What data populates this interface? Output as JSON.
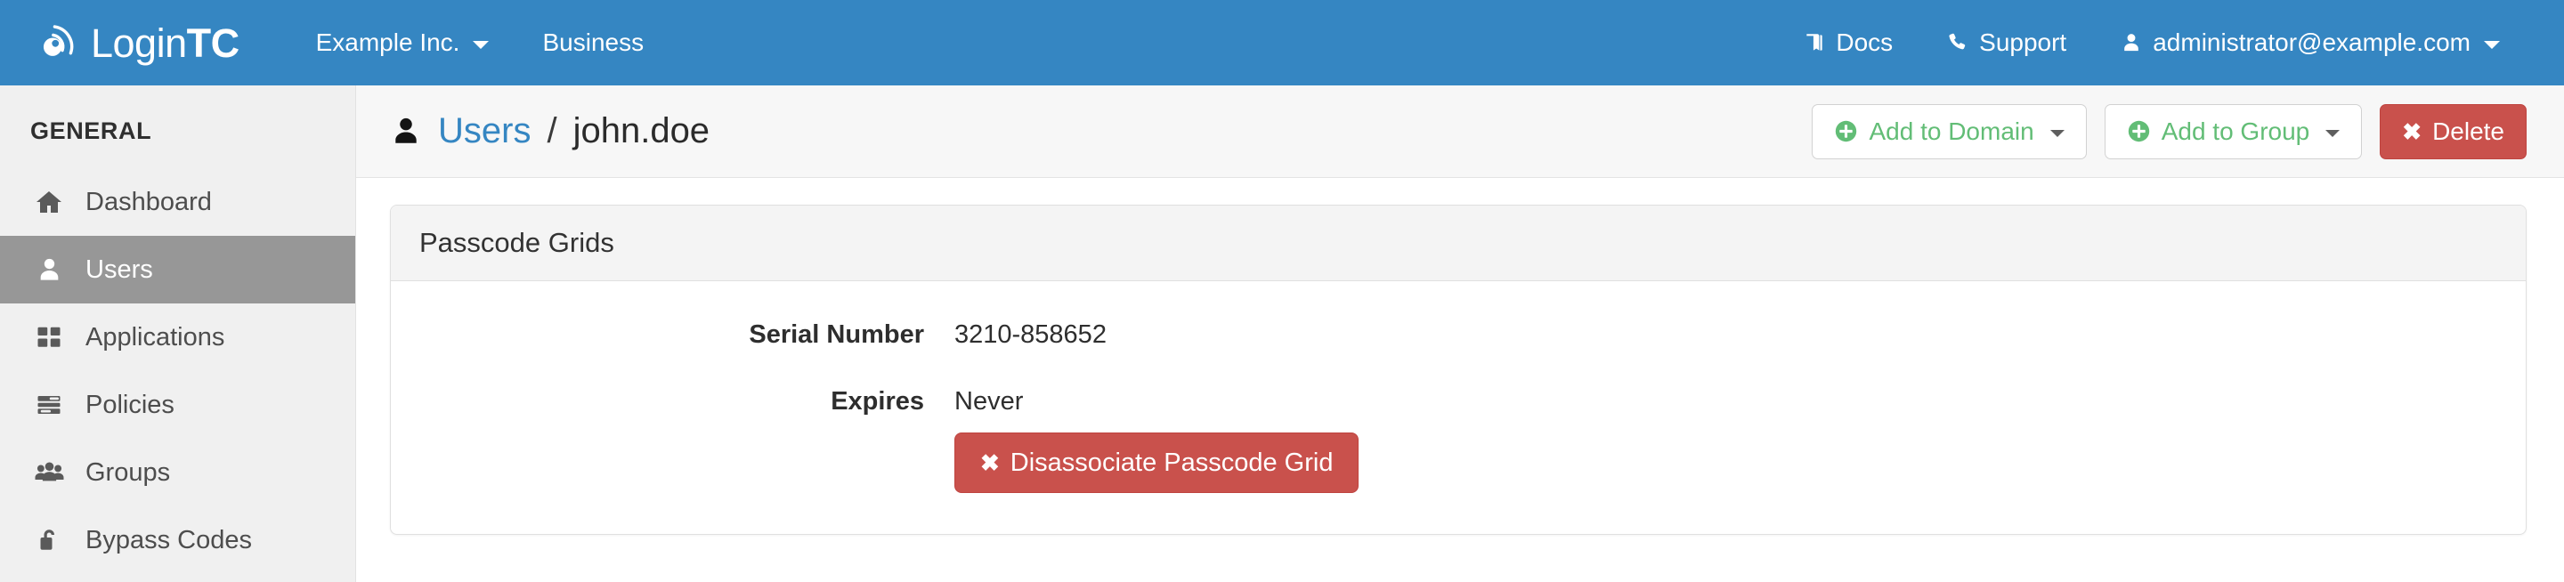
{
  "navbar": {
    "brand": {
      "icon": "lentil-signal-logo-icon",
      "text_light": "Login",
      "text_bold": "TC"
    },
    "left_items": [
      {
        "label": "Example Inc.",
        "caret": true
      },
      {
        "label": "Business",
        "caret": false
      }
    ],
    "right_items": [
      {
        "label": "Docs",
        "icon": "book-icon",
        "caret": false
      },
      {
        "label": "Support",
        "icon": "phone-icon",
        "caret": false
      },
      {
        "label": "administrator@example.com",
        "icon": "user-icon",
        "caret": true
      }
    ]
  },
  "sidebar": {
    "heading": "GENERAL",
    "items": [
      {
        "label": "Dashboard",
        "icon": "home-icon",
        "active": false
      },
      {
        "label": "Users",
        "icon": "user-icon",
        "active": true
      },
      {
        "label": "Applications",
        "icon": "grid-icon",
        "active": false
      },
      {
        "label": "Policies",
        "icon": "list-icon",
        "active": false
      },
      {
        "label": "Groups",
        "icon": "users-group-icon",
        "active": false
      },
      {
        "label": "Bypass Codes",
        "icon": "unlock-icon",
        "active": false
      }
    ]
  },
  "page_header": {
    "icon": "user-icon",
    "breadcrumb_link": "Users",
    "breadcrumb_separator": "/",
    "breadcrumb_current": "john.doe",
    "actions": [
      {
        "label": "Add to Domain",
        "icon": "plus-circle-icon",
        "caret": true,
        "style": "default"
      },
      {
        "label": "Add to Group",
        "icon": "plus-circle-icon",
        "caret": true,
        "style": "default"
      },
      {
        "label": "Delete",
        "icon": "x-icon",
        "caret": false,
        "style": "danger"
      }
    ]
  },
  "panel": {
    "title": "Passcode Grids",
    "fields": [
      {
        "label": "Serial Number",
        "value": "3210-858652"
      },
      {
        "label": "Expires",
        "value": "Never"
      }
    ],
    "action": {
      "label": "Disassociate Passcode Grid",
      "icon": "x-icon"
    }
  },
  "colors": {
    "navbar_blue": "#3586c2",
    "link_blue": "#3586c2",
    "sidebar_bg": "#f0f0f0",
    "sidebar_active": "#979797",
    "success_green": "#62bd76",
    "danger_red": "#c9514c",
    "panel_head_bg": "#f4f4f4"
  }
}
